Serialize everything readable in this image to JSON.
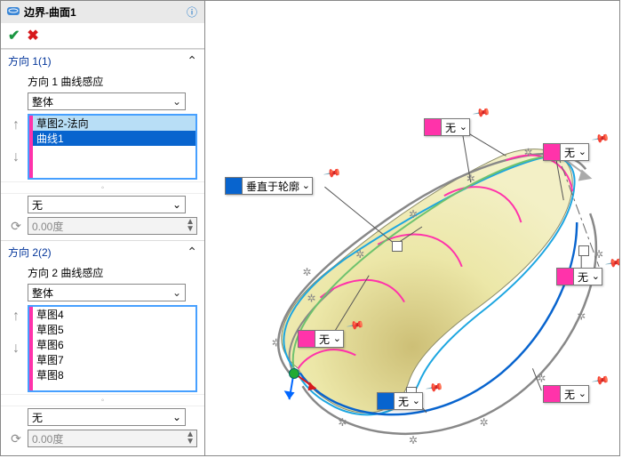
{
  "title": "边界-曲面1",
  "ok_tooltip": "OK",
  "cancel_tooltip": "Cancel",
  "dir1": {
    "head": "方向 1(1)",
    "sublabel": "方向 1 曲线感应",
    "influence": "整体",
    "items": [
      "草图2-法向",
      "曲线1"
    ],
    "items_sel": [
      0,
      1
    ],
    "sel_index_hi": 1,
    "tangent": "无",
    "angle": "0.00度"
  },
  "dir2": {
    "head": "方向 2(2)",
    "sublabel": "方向 2 曲线感应",
    "influence": "整体",
    "items": [
      "草图4",
      "草图5",
      "草图6",
      "草图7",
      "草图8"
    ],
    "tangent": "无",
    "angle": "0.00度"
  },
  "callouts": {
    "perp": "垂直于轮廓",
    "none": "无"
  },
  "chart_data": null
}
